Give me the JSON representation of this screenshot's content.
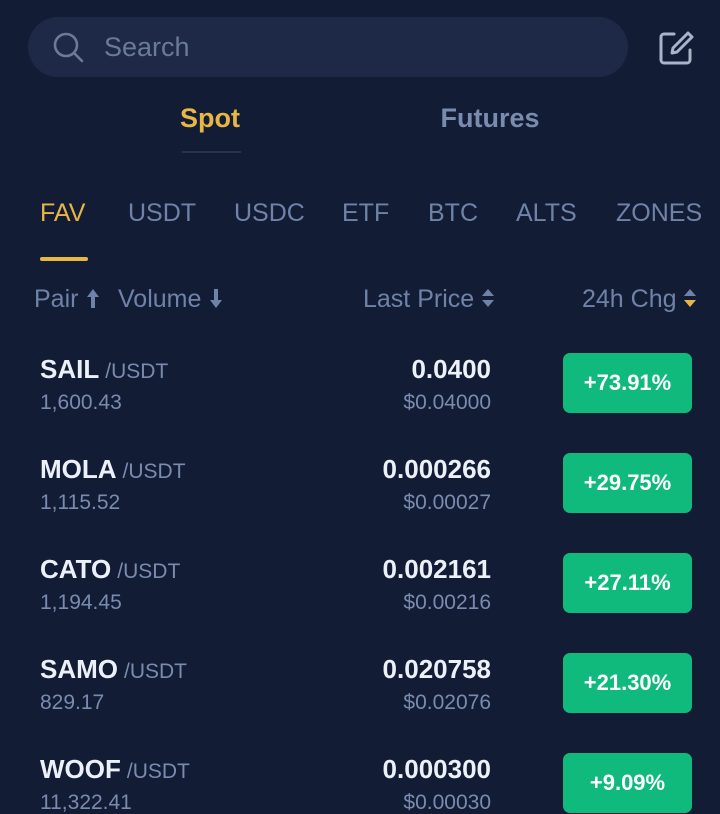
{
  "search": {
    "placeholder": "Search"
  },
  "market_tabs": [
    {
      "label": "Spot",
      "active": true
    },
    {
      "label": "Futures",
      "active": false
    }
  ],
  "quote_tabs": [
    {
      "label": "FAV",
      "active": true
    },
    {
      "label": "USDT",
      "active": false
    },
    {
      "label": "USDC",
      "active": false
    },
    {
      "label": "ETF",
      "active": false
    },
    {
      "label": "BTC",
      "active": false
    },
    {
      "label": "ALTS",
      "active": false
    },
    {
      "label": "ZONES",
      "active": false
    }
  ],
  "columns": {
    "pair": "Pair",
    "volume": "Volume",
    "last_price": "Last Price",
    "change": "24h Chg"
  },
  "rows": [
    {
      "base": "SAIL",
      "quote": "/USDT",
      "volume": "1,600.43",
      "price": "0.0400",
      "fiat": "$0.04000",
      "change": "+73.91%"
    },
    {
      "base": "MOLA",
      "quote": "/USDT",
      "volume": "1,115.52",
      "price": "0.000266",
      "fiat": "$0.00027",
      "change": "+29.75%"
    },
    {
      "base": "CATO",
      "quote": "/USDT",
      "volume": "1,194.45",
      "price": "0.002161",
      "fiat": "$0.00216",
      "change": "+27.11%"
    },
    {
      "base": "SAMO",
      "quote": "/USDT",
      "volume": "829.17",
      "price": "0.020758",
      "fiat": "$0.02076",
      "change": "+21.30%"
    },
    {
      "base": "WOOF",
      "quote": "/USDT",
      "volume": "11,322.41",
      "price": "0.000300",
      "fiat": "$0.00030",
      "change": "+9.09%"
    }
  ],
  "colors": {
    "background": "#131c35",
    "accent": "#e7b644",
    "positive": "#0fba7c",
    "muted_text": "#7a8bb0"
  },
  "icons": {
    "search": "search-icon",
    "edit": "edit-icon",
    "sort_up": "arrow-up-icon",
    "sort_down": "arrow-down-icon",
    "sort_both": "sort-icon"
  }
}
